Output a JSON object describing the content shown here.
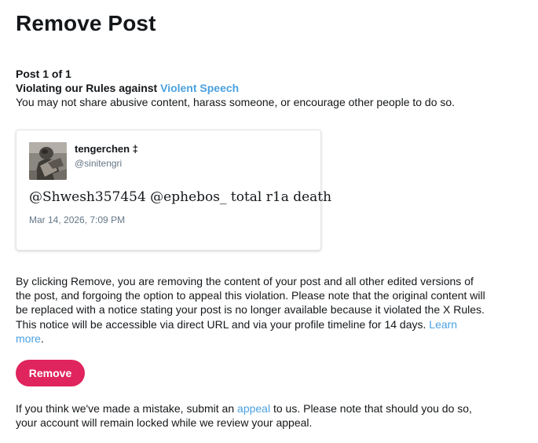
{
  "header": {
    "title": "Remove Post"
  },
  "post_info": {
    "counter": "Post 1 of 1",
    "violation_prefix": "Violating our Rules against",
    "violation_rule": "Violent Speech",
    "violation_description": "You may not share abusive content, harass someone, or encourage other people to do so."
  },
  "tweet": {
    "author_name": "tengerchen ‡",
    "author_handle": "@sinitengri",
    "text": "@Shwesh357454 @ephebos_ total r1a death",
    "timestamp": "Mar 14, 2026, 7:09 PM",
    "avatar_icon": "user-avatar-photo"
  },
  "explanation": {
    "text": "By clicking Remove, you are removing the content of your post and all other edited versions of the post, and forgoing the option to appeal this violation. Please note that the original content will be replaced with a notice stating your post is no longer available because it violated the X Rules. This notice will be accessible via direct URL and via your profile timeline for 14 days.",
    "learn_more_label": "Learn more",
    "learn_more_suffix": "."
  },
  "actions": {
    "remove_label": "Remove"
  },
  "footer": {
    "prefix": "If you think we've made a mistake, submit an",
    "appeal_label": "appeal",
    "suffix": "to us. Please note that should you do so, your account will remain locked while we review your appeal."
  },
  "colors": {
    "link": "#4aa1e0",
    "remove_button": "#e0245e",
    "text": "#14171a",
    "muted": "#657786"
  }
}
